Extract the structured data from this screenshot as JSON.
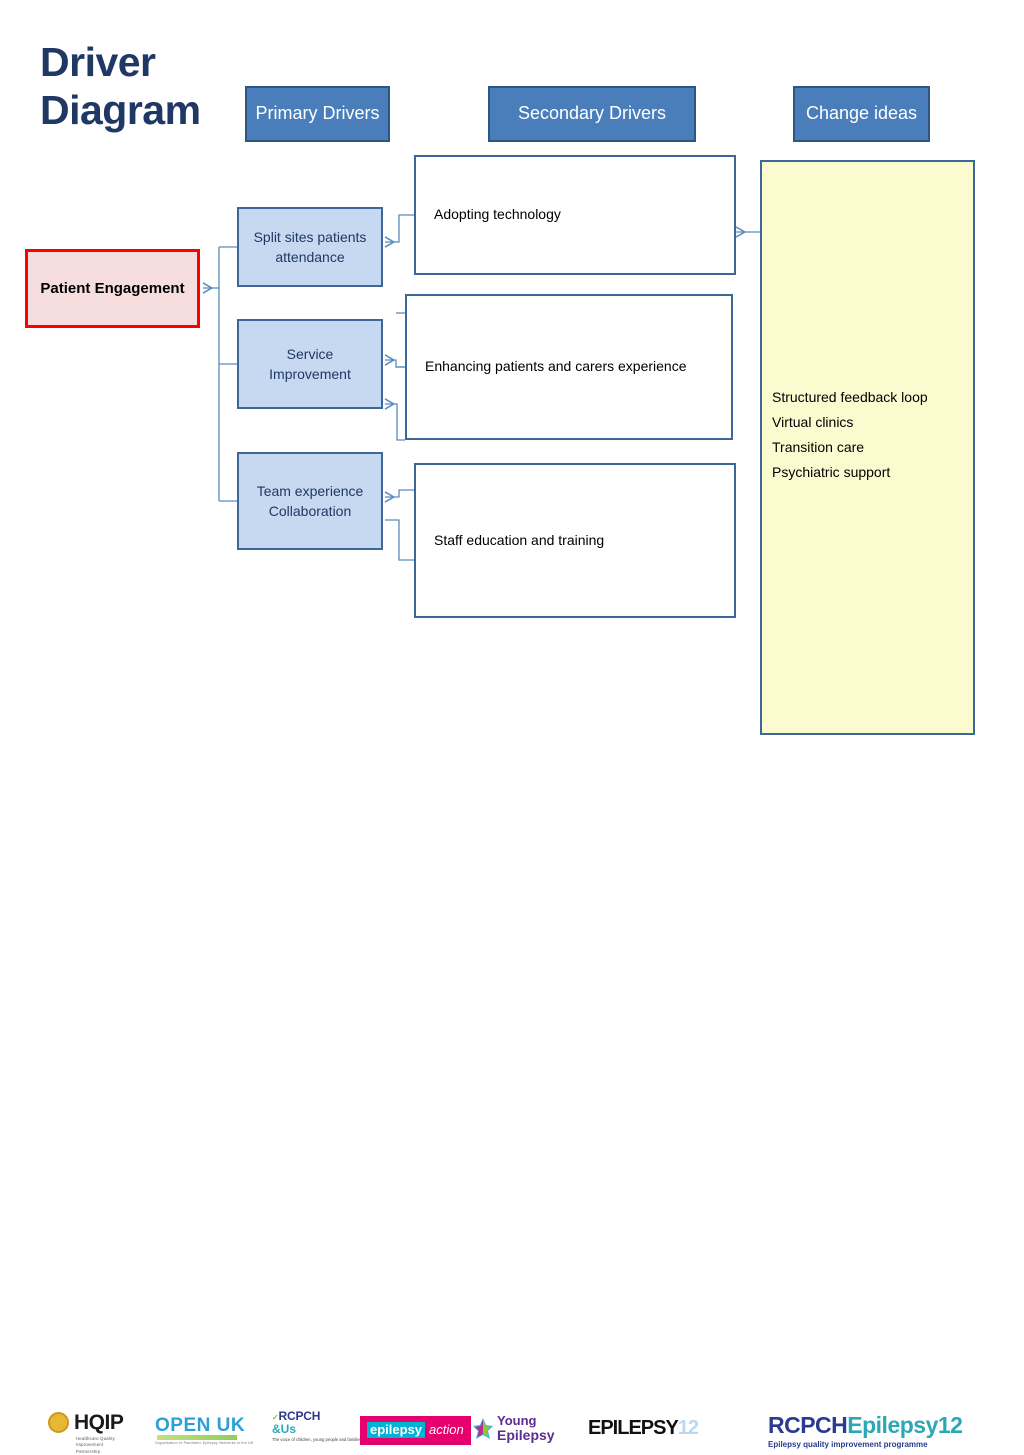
{
  "title": "Driver Diagram",
  "headers": {
    "primary": "Primary Drivers",
    "secondary": "Secondary Drivers",
    "change": "Change ideas"
  },
  "aim": {
    "label": "Patient Engagement",
    "border_color": "#ff0000",
    "fill_color": "#f7dede"
  },
  "primary_drivers": [
    {
      "label": "Split sites patients attendance"
    },
    {
      "label": "Service Improvement"
    },
    {
      "label": "Team experience Collaboration"
    }
  ],
  "secondary_drivers": [
    {
      "label": "Adopting technology"
    },
    {
      "label": "Enhancing patients and carers experience"
    },
    {
      "label": "Staff education and training"
    }
  ],
  "change_ideas": [
    "Structured feedback loop",
    "Virtual clinics",
    "Transition care",
    "Psychiatric support"
  ],
  "colors": {
    "header_blue": "#4a7ebb",
    "header_border": "#2e5584",
    "primary_fill": "#c6d9f0",
    "box_border": "#3d6699",
    "change_fill": "#fcfbcf",
    "title_navy": "#1f3864",
    "connector": "#5b8cc0"
  },
  "logos": {
    "hqip": {
      "name": "HQIP",
      "subtitle": "Healthcare Quality Improvement Partnership"
    },
    "open_uk": {
      "name": "OPEN UK",
      "subtitle": "Organisation of Paediatric Epilepsy Networks in the UK"
    },
    "rcpch_us": {
      "line1": "RCPCH",
      "line2": "&Us",
      "subtitle": "The voice of children, young people and families"
    },
    "epilepsy_action": {
      "word1": "epilepsy",
      "word2": "action"
    },
    "young_epilepsy": {
      "word1": "Young",
      "word2": "Epilepsy"
    },
    "epilepsy12": {
      "word1": "EPILEPSY",
      "word2": "12"
    },
    "rcpch_epilepsy12": {
      "word1": "RCPCH",
      "word2": "Epilepsy12",
      "subtitle": "Epilepsy quality improvement programme"
    }
  }
}
